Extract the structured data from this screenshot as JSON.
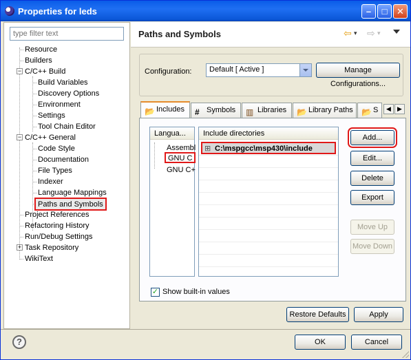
{
  "window": {
    "title": "Properties for leds"
  },
  "filter": {
    "placeholder": "type filter text"
  },
  "tree": {
    "items": [
      {
        "label": "Resource"
      },
      {
        "label": "Builders"
      },
      {
        "label": "C/C++ Build",
        "expander": "−"
      },
      {
        "label": "Build Variables"
      },
      {
        "label": "Discovery Options"
      },
      {
        "label": "Environment"
      },
      {
        "label": "Settings"
      },
      {
        "label": "Tool Chain Editor"
      },
      {
        "label": "C/C++ General",
        "expander": "−"
      },
      {
        "label": "Code Style"
      },
      {
        "label": "Documentation"
      },
      {
        "label": "File Types"
      },
      {
        "label": "Indexer"
      },
      {
        "label": "Language Mappings"
      },
      {
        "label": "Paths and Symbols"
      },
      {
        "label": "Project References"
      },
      {
        "label": "Refactoring History"
      },
      {
        "label": "Run/Debug Settings"
      },
      {
        "label": "Task Repository",
        "expander": "+"
      },
      {
        "label": "WikiText"
      }
    ]
  },
  "page": {
    "title": "Paths and Symbols",
    "nav": {
      "back_icon": "⇦",
      "forward_icon": "⇨",
      "dropdown_icon": "▾"
    }
  },
  "configuration": {
    "label": "Configuration:",
    "value": "Default  [ Active ]",
    "manage_button": "Manage Configurations..."
  },
  "tabs": [
    {
      "label": "Includes",
      "icon": "📂"
    },
    {
      "label": "Symbols",
      "icon": "#"
    },
    {
      "label": "Libraries",
      "icon": "▥"
    },
    {
      "label": "Library Paths",
      "icon": "📂"
    },
    {
      "label": "S",
      "icon": "📂"
    }
  ],
  "languages": {
    "header": "Langua...",
    "items": [
      "Assembl",
      "GNU C",
      "GNU C+"
    ]
  },
  "includes": {
    "header": "Include directories",
    "items": [
      "C:\\mspgcc\\msp430\\include"
    ]
  },
  "buttons": {
    "add": "Add...",
    "edit": "Edit...",
    "delete": "Delete",
    "export": "Export",
    "move_up": "Move Up",
    "move_down": "Move Down",
    "restore_defaults": "Restore Defaults",
    "apply": "Apply",
    "ok": "OK",
    "cancel": "Cancel"
  },
  "show_builtin": {
    "label": "Show built-in values",
    "checked": true
  },
  "colors": {
    "highlight_red": "#e01818",
    "titlebar_blue": "#0a5ce8"
  }
}
